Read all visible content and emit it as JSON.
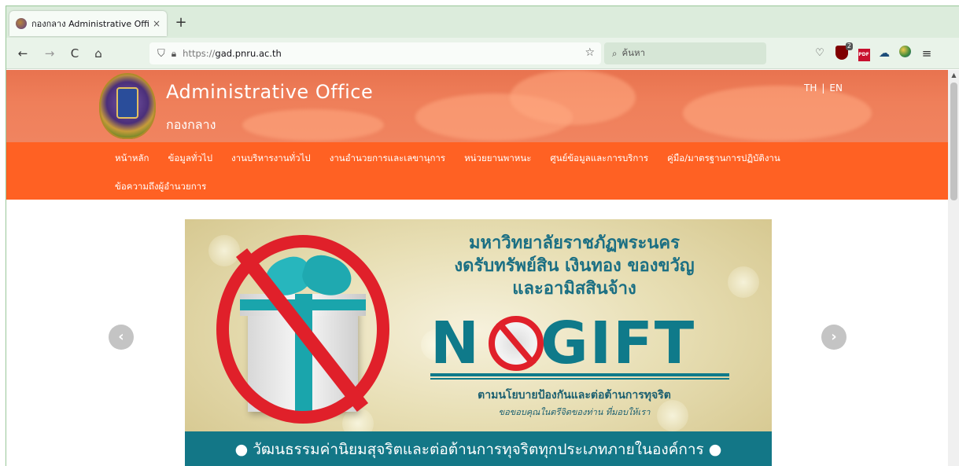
{
  "browser": {
    "tab_title": "กองกลาง Administrative Office",
    "tab_close": "×",
    "new_tab": "+",
    "back": "←",
    "forward": "→",
    "reload": "C",
    "home": "⌂",
    "url_prefix": "https://",
    "url_host": "gad.pnru.ac.th",
    "bookmark_star": "☆",
    "search_placeholder": "ค้นหา",
    "ublock_badge": "2",
    "pdf_label": "PDF"
  },
  "header": {
    "title": "Administrative Office",
    "subtitle": "กองกลาง",
    "lang_th": "TH",
    "lang_sep": "|",
    "lang_en": "EN"
  },
  "menu": {
    "row1": [
      "หน้าหลัก",
      "ข้อมูลทั่วไป",
      "งานบริหารงานทั่วไป",
      "งานอำนวยการและเลขานุการ",
      "หน่วยยานพาหนะ",
      "ศูนย์ข้อมูลและการบริการ",
      "คู่มือ/มาตรฐานการปฏิบัติงาน"
    ],
    "row2": [
      "ข้อความถึงผู้อำนวยการ"
    ]
  },
  "slide": {
    "heading_line1": "มหาวิทยาลัยราชภัฏพระนคร",
    "heading_line2": "งดรับทรัพย์สิน เงินทอง ของขวัญ",
    "heading_line3": "และอามิสสินจ้าง",
    "gift_n": "N",
    "gift_rest": "GIFT",
    "policy": "ตามนโยบายป้องกันและต่อต้านการทุจริต",
    "thanks": "ขอขอบคุณในตรีจิตของท่าน ที่มอบให้เรา",
    "footer": "● วัฒนธรรมค่านิยมสุจริตและต่อต้านการทุจริตทุกประเภทภายในองค์การ ●"
  },
  "slider_nav": {
    "prev": "‹",
    "next": "›"
  },
  "colors": {
    "menu_bg": "#ff6123",
    "header_bg": "#ef7f5a",
    "slide_accent": "#137787",
    "no_sign": "#e0202a"
  }
}
